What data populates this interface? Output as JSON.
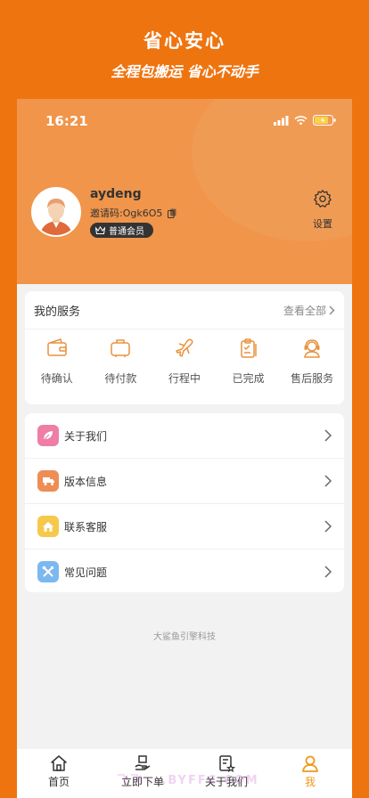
{
  "promo": {
    "title": "省心安心",
    "subtitle": "全程包搬运 省心不动手"
  },
  "status_bar": {
    "time": "16:21"
  },
  "profile": {
    "username": "aydeng",
    "invite_code": "邀请码:Ogk6O5",
    "member_badge": "普通会员",
    "settings_label": "设置"
  },
  "services": {
    "title": "我的服务",
    "view_all": "查看全部",
    "items": [
      {
        "label": "待确认",
        "icon": "wallet-icon"
      },
      {
        "label": "待付款",
        "icon": "luggage-icon"
      },
      {
        "label": "行程中",
        "icon": "plane-icon"
      },
      {
        "label": "已完成",
        "icon": "clipboard-icon"
      },
      {
        "label": "售后服务",
        "icon": "headset-icon"
      }
    ]
  },
  "menu": {
    "items": [
      {
        "label": "关于我们",
        "icon": "leaf-icon",
        "color": "#EE7EA6"
      },
      {
        "label": "版本信息",
        "icon": "truck-icon",
        "color": "#EE8D55"
      },
      {
        "label": "联系客服",
        "icon": "home-icon",
        "color": "#F6C84B"
      },
      {
        "label": "常见问题",
        "icon": "tools-icon",
        "color": "#7CB8F0"
      }
    ]
  },
  "footer": {
    "text": "大鲨鱼引擎科技"
  },
  "tabs": [
    {
      "label": "首页",
      "icon": "home-outline-icon"
    },
    {
      "label": "立即下单",
      "icon": "box-hand-icon"
    },
    {
      "label": "关于我们",
      "icon": "document-star-icon"
    },
    {
      "label": "我",
      "icon": "user-icon",
      "active": true
    }
  ],
  "watermark": "飞飞 ...BYFFC.COM",
  "colors": {
    "brand": "#EE7410",
    "header": "#F0954A",
    "active_tab": "#EE9A1A"
  }
}
